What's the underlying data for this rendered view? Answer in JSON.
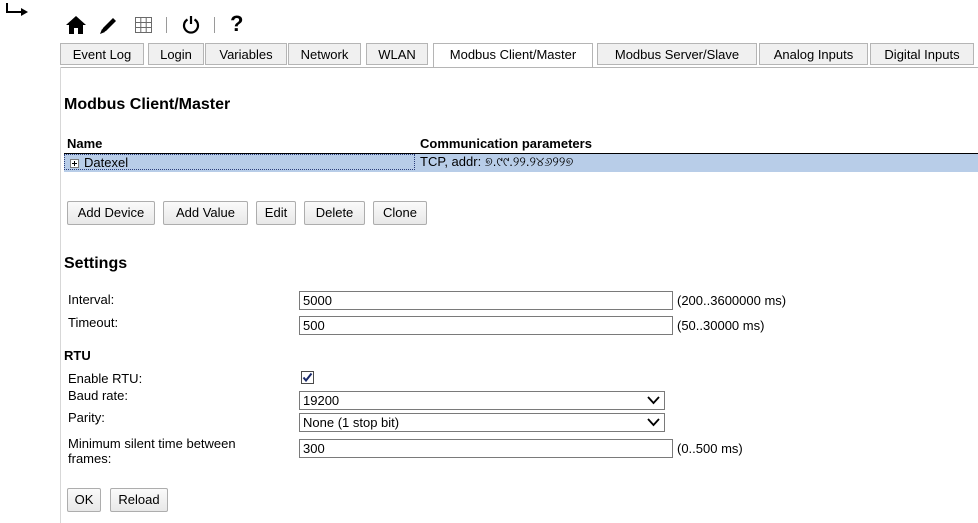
{
  "toolbar": {
    "icons": [
      "home-icon",
      "edit-icon",
      "grid-icon",
      "refresh-icon",
      "help-icon"
    ],
    "help_glyph": "?"
  },
  "tabs": [
    {
      "label": "Event Log"
    },
    {
      "label": "Login"
    },
    {
      "label": "Variables"
    },
    {
      "label": "Network"
    },
    {
      "label": "WLAN"
    },
    {
      "label": "Modbus Client/Master",
      "active": true
    },
    {
      "label": "Modbus Server/Slave"
    },
    {
      "label": "Analog Inputs"
    },
    {
      "label": "Digital Inputs"
    }
  ],
  "modbus": {
    "title": "Modbus Client/Master",
    "columns": {
      "name": "Name",
      "params": "Communication parameters"
    },
    "devices": [
      {
        "name": "Datexel",
        "params": "TCP, addr: ୭.୯୯.୨୨.୨୪୬୨୨୭"
      }
    ],
    "buttons": {
      "add_device": "Add Device",
      "add_value": "Add Value",
      "edit": "Edit",
      "delete": "Delete",
      "clone": "Clone"
    }
  },
  "settings": {
    "title": "Settings",
    "interval": {
      "label": "Interval:",
      "value": "5000",
      "range": "(200..3600000 ms)"
    },
    "timeout": {
      "label": "Timeout:",
      "value": "500",
      "range": "(50..30000 ms)"
    },
    "rtu": {
      "title": "RTU",
      "enable": {
        "label": "Enable RTU:",
        "checked": true
      },
      "baud": {
        "label": "Baud rate:",
        "value": "19200"
      },
      "parity": {
        "label": "Parity:",
        "value": "None (1 stop bit)"
      },
      "silent": {
        "label_line1": "Minimum silent time between",
        "label_line2": "frames:",
        "value": "300",
        "range": "(0..500 ms)"
      }
    },
    "buttons": {
      "ok": "OK",
      "reload": "Reload"
    }
  }
}
